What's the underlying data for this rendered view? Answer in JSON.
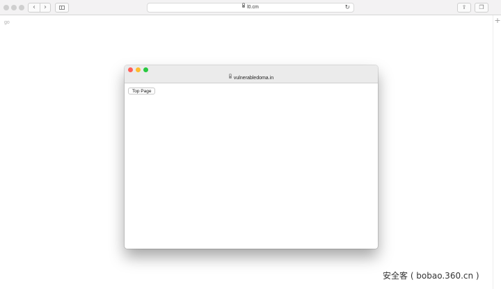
{
  "browser": {
    "back_glyph": "‹",
    "forward_glyph": "›",
    "url": "l0.cm",
    "reload_glyph": "↻",
    "share_glyph": "⇪",
    "tabs_glyph": "❐",
    "new_tab_glyph": "+"
  },
  "page": {
    "go_text": "go"
  },
  "popup": {
    "url": "vulnerabledoma.in",
    "button_label": "Top Page"
  },
  "watermark": {
    "text": "安全客 ( bobao.360.cn )"
  },
  "colors": {
    "close": "#fe5f57",
    "minimize": "#febc2e",
    "maximize": "#28c840"
  }
}
